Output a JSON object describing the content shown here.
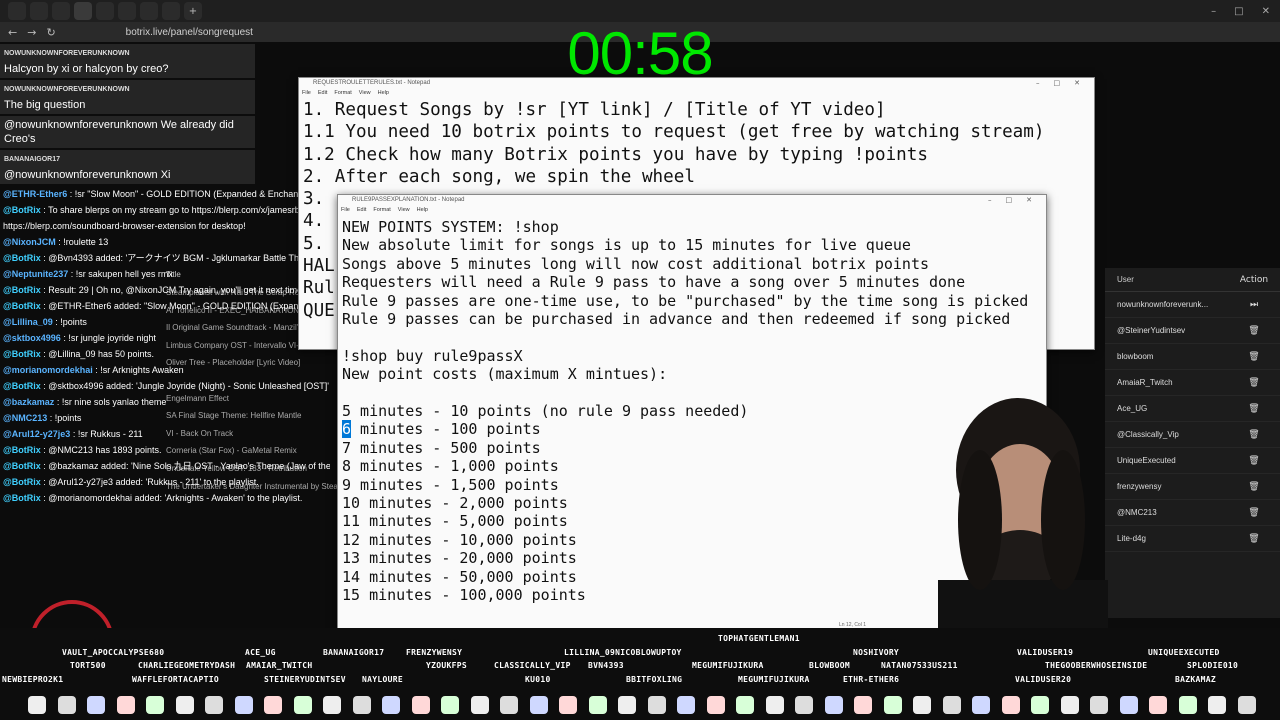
{
  "browser": {
    "url": "botrix.live/panel/songrequest",
    "back": "←",
    "forward": "→",
    "reload": "↻",
    "win_min": "–",
    "win_max": "□",
    "win_close": "✕"
  },
  "timer": "00:58",
  "chat": {
    "highlights": [
      {
        "name": "NOWUNKNOWNFOREVERUNKNOWN",
        "text": "Halcyon by xi or halcyon by creo?"
      },
      {
        "name": "NOWUNKNOWNFOREVERUNKNOWN",
        "text": "The big question"
      },
      {
        "name": "",
        "text": "@nowunknownforeverunknown We already did Creo's"
      },
      {
        "name": "BANANAIGOR17",
        "text": "@nowunknownforeverunknown Xi"
      }
    ],
    "messages": [
      {
        "user": "@ETHR-Ether6",
        "text": " : !sr \"Slow Moon\" - GOLD EDITION (Expanded & Enchanced) - STREETS OF RAGE 2"
      },
      {
        "user": "@BotRix",
        "text": " : To share blerps on my stream go to https://blerp.com/x/jamesrbasted_a2pfk for mobile and"
      },
      {
        "user": "",
        "text": "https://blerp.com/soundboard-browser-extension for desktop!"
      },
      {
        "user": "@NixonJCM",
        "text": " : !roulette 13"
      },
      {
        "user": "@BotRix",
        "text": " : @Bvn4393 added: 'アークナイツ BGM - Jgklumarkar Battle Theme 02 | Arknights/明日方舟 統合戦略 OST' to the playlist."
      },
      {
        "user": "@Neptunite237",
        "text": " : !sr sakupen hell yes rmx"
      },
      {
        "user": "@BotRix",
        "text": " : Result: 29 | Oh no, @NixonJCM Try again, you'll get it next time You lost 20 points."
      },
      {
        "user": "@BotRix",
        "text": " : @ETHR-Ether6 added: \"Slow Moon\" - GOLD EDITION (Expanded & Enhanced) - STREETS OF RAGE 2' to the playlist."
      },
      {
        "user": "@Lillina_09",
        "text": " : !points"
      },
      {
        "user": "@sktbox4996",
        "text": " : !sr jungle joyride night"
      },
      {
        "user": "@BotRix",
        "text": " : @Lillina_09 has 50 points."
      },
      {
        "user": "@morianomordekhai",
        "text": " : !sr Arknights Awaken"
      },
      {
        "user": "@BotRix",
        "text": " : @sktbox4996 added: 'Jungle Joyride (Night) - Sonic Unleashed [OST]' to the playlist."
      },
      {
        "user": "@bazkamaz",
        "text": " : !sr nine sols yanlao theme"
      },
      {
        "user": "@NMC213",
        "text": " : !points"
      },
      {
        "user": "@Arul12-y27je3",
        "text": " : !sr Rukkus - 211"
      },
      {
        "user": "@BotRix",
        "text": " : @NMC213 has 1893 points."
      },
      {
        "user": "@BotRix",
        "text": " : @bazkamaz added: 'Nine Sols 九日 OST - Yanlao's Theme (Jaw of the Machine)' to the playlist."
      },
      {
        "user": "@BotRix",
        "text": " : @Arul12-y27je3 added: 'Rukkus - 211' to the playlist."
      },
      {
        "user": "@BotRix",
        "text": " : @morianomordekhai added: 'Arknights - Awaken' to the playlist."
      }
    ]
  },
  "songlist": {
    "title_header": "Title",
    "rows": [
      "Steampianist with Nai - The Scrap Ro",
      "Ar Tonelico II - EXEC_HAIBANATION/. with Lyrics",
      "Il Original Game Soundtrack - Manzil's H",
      "Limbus Company OST - Intervallo VI-EX Boss 1",
      "Oliver Tree - Placeholder [Lyric Video]",
      "",
      "Engelmann Effect",
      "SA Final Stage Theme: Hellfire Mantle",
      "VI - Back On Track",
      "Corneria (Star Fox) - GaMetal Remix",
      "Undertale Yellow OST: 133 - Retribution",
      "The Undertaker's Daughter Instrumental by Stea"
    ]
  },
  "notepad1": {
    "title": "REQUESTROULETTERULES.txt - Notepad",
    "menu": [
      "File",
      "Edit",
      "Format",
      "View",
      "Help"
    ],
    "lines": [
      "1. Request Songs by !sr [YT link] / [Title of YT video]",
      "1.1 You need 10 botrix points to request (get free by watching stream)",
      "1.2 Check how many Botrix points you have by typing !points",
      "2. After each song, we spin the wheel",
      "3.",
      "4.",
      "5.                                                                  s.",
      "HAL",
      "Rul",
      "QUE"
    ]
  },
  "notepad2": {
    "title": "RULE9PASSEXPLANATION.txt - Notepad",
    "menu": [
      "File",
      "Edit",
      "Format",
      "View",
      "Help"
    ],
    "lines_top": [
      "NEW POINTS SYSTEM: !shop",
      "New absolute limit for songs is up to 15 minutes for live queue",
      "Songs above 5 minutes long will now cost additional botrix points",
      "Requesters will need a Rule 9 pass to have a song over 5 minutes done",
      "Rule 9 passes are one-time use, to be \"purchased\" by the time song is picked",
      "Rule 9 passes can be purchased in advance and then redeemed if song picked",
      "",
      "!shop buy rule9passX",
      "New point costs (maximum X mintues):",
      "",
      "5 minutes - 10 points (no rule 9 pass needed)"
    ],
    "selected_char": "6",
    "line6_rest": " minutes - 100 points",
    "lines_bottom": [
      "7 minutes - 500 points",
      "8 minutes - 1,000 points",
      "9 minutes - 1,500 points",
      "10 minutes - 2,000 points",
      "11 minutes - 5,000 points",
      "12 minutes - 10,000 points",
      "13 minutes - 20,000 points",
      "14 minutes - 50,000 points",
      "15 minutes - 100,000 points"
    ],
    "status": "Ln 12, Col 1"
  },
  "right_panel": {
    "header_user": "User",
    "header_action": "Action",
    "rows": [
      {
        "user": "nowunknownforeverunk...",
        "action": "⏭"
      },
      {
        "user": "@SteinerYudintsev",
        "action": "🗑"
      },
      {
        "user": "blowboom",
        "action": "🗑"
      },
      {
        "user": "AmaiaR_Twitch",
        "action": "🗑"
      },
      {
        "user": "Ace_UG",
        "action": "🗑"
      },
      {
        "user": "@Classically_Vip",
        "action": "🗑"
      },
      {
        "user": "UniqueExecuted",
        "action": "🗑"
      },
      {
        "user": "frenzywensy",
        "action": "🗑"
      },
      {
        "user": "@NMC213",
        "action": "🗑"
      },
      {
        "user": "Lite-d4g",
        "action": "🗑"
      }
    ]
  },
  "chatters": [
    {
      "name": "TOPHATGENTLEMAN1"
    },
    {
      "name": "VAULT_APOCCALYPSE680"
    },
    {
      "name": "ACE_UG"
    },
    {
      "name": "BANANAIGOR17"
    },
    {
      "name": "FRENZYWENSY"
    },
    {
      "name": "LILLINA_09NICOBLOWUPTOY"
    },
    {
      "name": "NOSHIVORY"
    },
    {
      "name": "VALIDUSER19"
    },
    {
      "name": "UNIQUEEXECUTED"
    },
    {
      "name": "TORT500"
    },
    {
      "name": "CHARLIEGEOMETRYDASH"
    },
    {
      "name": "AMAIAR_TWITCH"
    },
    {
      "name": "YZOUKFPS"
    },
    {
      "name": "CLASSICALLY_VIP"
    },
    {
      "name": "BVN4393"
    },
    {
      "name": "MEGUMIFUJIKURA"
    },
    {
      "name": "BLOWBOOM"
    },
    {
      "name": "NATAN07533US211"
    },
    {
      "name": "THEGOOBERWHOSEINSIDE"
    },
    {
      "name": "SPLODIE010"
    },
    {
      "name": "NEWBIEPRO2K1"
    },
    {
      "name": "WAFFLEFORTACAPTIO"
    },
    {
      "name": "STEINERYUDINTSEV"
    },
    {
      "name": "NAYLOURE"
    },
    {
      "name": "KU010"
    },
    {
      "name": "BBITFOXLING"
    },
    {
      "name": "MEGUMIFUJIKURA"
    },
    {
      "name": "ETHR-ETHER6"
    },
    {
      "name": "VALIDUSER20"
    },
    {
      "name": "BAZKAMAZ"
    }
  ],
  "colors": {
    "timer": "#00e800",
    "accent": "#0078d7",
    "bot": "#40d0ff",
    "vault_ring": "#c0202a"
  }
}
